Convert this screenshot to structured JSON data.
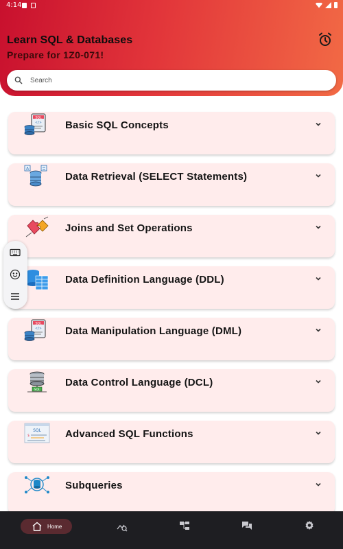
{
  "status_bar": {
    "time": "4:14"
  },
  "header": {
    "title": "Learn SQL & Databases",
    "subtitle": "Prepare for 1Z0-071!",
    "alarm_icon": "alarm-clock-icon"
  },
  "search": {
    "placeholder": "Search",
    "value": ""
  },
  "topics": [
    {
      "title": "Basic SQL Concepts",
      "icon": "sql-document-icon"
    },
    {
      "title": "Data Retrieval (SELECT Statements)",
      "icon": "database-retrieval-icon"
    },
    {
      "title": "Joins and Set Operations",
      "icon": "puzzle-join-icon"
    },
    {
      "title": "Data Definition Language (DDL)",
      "icon": "database-table-icon"
    },
    {
      "title": "Data Manipulation Language (DML)",
      "icon": "sql-document-icon"
    },
    {
      "title": "Data Control Language (DCL)",
      "icon": "database-server-icon"
    },
    {
      "title": "Advanced SQL Functions",
      "icon": "sql-editor-icon"
    },
    {
      "title": "Subqueries",
      "icon": "database-network-icon"
    }
  ],
  "floating_toolbar": {
    "items": [
      "keyboard-icon",
      "emoji-icon",
      "menu-icon"
    ]
  },
  "bottom_nav": {
    "items": [
      {
        "label": "Home",
        "icon": "home-icon",
        "active": true
      },
      {
        "label": "",
        "icon": "chart-search-icon",
        "active": false
      },
      {
        "label": "",
        "icon": "hierarchy-icon",
        "active": false
      },
      {
        "label": "",
        "icon": "chat-icon",
        "active": false
      },
      {
        "label": "",
        "icon": "settings-icon",
        "active": false
      }
    ]
  },
  "colors": {
    "header_start": "#c8102e",
    "header_end": "#f26a45",
    "card_background": "#ffecec",
    "nav_background": "#1e1e22",
    "nav_active": "#5a2a30"
  }
}
